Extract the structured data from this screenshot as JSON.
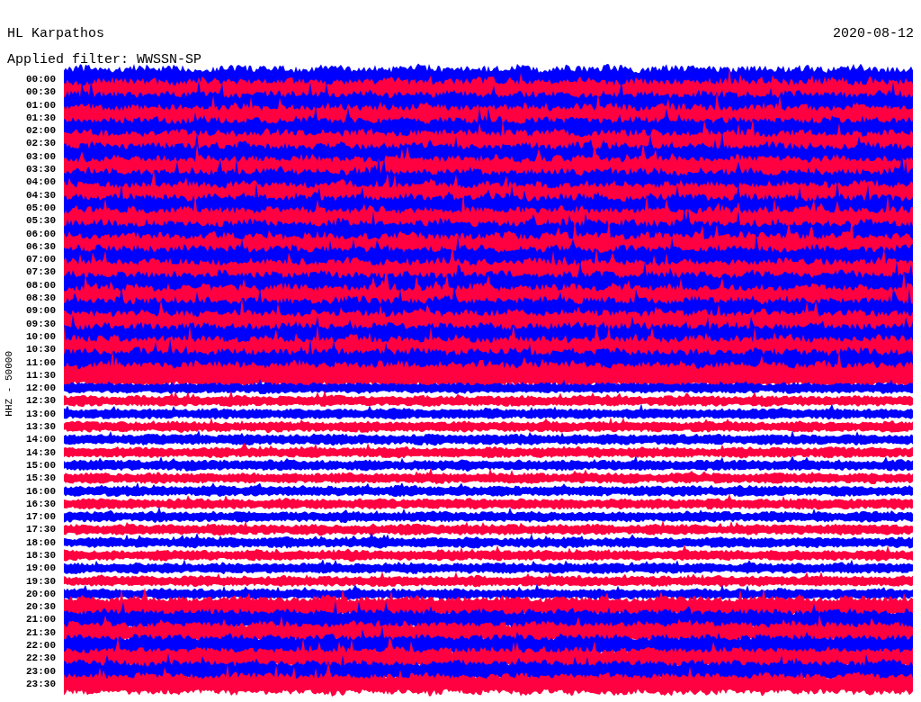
{
  "station": "HL Karpathos",
  "date": "2020-08-12",
  "filter": "Applied filter: WWSSN-SP",
  "channel": "HHZ - 50000",
  "rows": [
    {
      "time": "00:00",
      "color": "#0000ff"
    },
    {
      "time": "00:30",
      "color": "#ff0040"
    },
    {
      "time": "01:00",
      "color": "#0000ff"
    },
    {
      "time": "01:30",
      "color": "#ff0040"
    },
    {
      "time": "02:00",
      "color": "#0000ff"
    },
    {
      "time": "02:30",
      "color": "#ff0040"
    },
    {
      "time": "03:00",
      "color": "#0000ff"
    },
    {
      "time": "03:30",
      "color": "#ff0040"
    },
    {
      "time": "04:00",
      "color": "#0000ff"
    },
    {
      "time": "04:30",
      "color": "#ff0040"
    },
    {
      "time": "05:00",
      "color": "#0000ff"
    },
    {
      "time": "05:30",
      "color": "#ff0040"
    },
    {
      "time": "06:00",
      "color": "#0000ff"
    },
    {
      "time": "06:30",
      "color": "#ff0040"
    },
    {
      "time": "07:00",
      "color": "#0000ff"
    },
    {
      "time": "07:30",
      "color": "#ff0040"
    },
    {
      "time": "08:00",
      "color": "#0000ff"
    },
    {
      "time": "08:30",
      "color": "#ff0040"
    },
    {
      "time": "09:00",
      "color": "#0000ff"
    },
    {
      "time": "09:30",
      "color": "#ff0040"
    },
    {
      "time": "10:00",
      "color": "#0000ff"
    },
    {
      "time": "10:30",
      "color": "#ff0040"
    },
    {
      "time": "11:00",
      "color": "#0000ff"
    },
    {
      "time": "11:30",
      "color": "#ff0040"
    },
    {
      "time": "12:00",
      "color": "#0000ff"
    },
    {
      "time": "12:30",
      "color": "#ff0040"
    },
    {
      "time": "13:00",
      "color": "#0000ff"
    },
    {
      "time": "13:30",
      "color": "#ff0040"
    },
    {
      "time": "14:00",
      "color": "#0000ff"
    },
    {
      "time": "14:30",
      "color": "#ff0040"
    },
    {
      "time": "15:00",
      "color": "#0000ff"
    },
    {
      "time": "15:30",
      "color": "#ff0040"
    },
    {
      "time": "16:00",
      "color": "#0000ff"
    },
    {
      "time": "16:30",
      "color": "#ff0040"
    },
    {
      "time": "17:00",
      "color": "#0000ff"
    },
    {
      "time": "17:30",
      "color": "#ff0040"
    },
    {
      "time": "18:00",
      "color": "#0000ff"
    },
    {
      "time": "18:30",
      "color": "#ff0040"
    },
    {
      "time": "19:00",
      "color": "#0000ff"
    },
    {
      "time": "19:30",
      "color": "#ff0040"
    },
    {
      "time": "20:00",
      "color": "#0000ff"
    },
    {
      "time": "20:30",
      "color": "#ff0040"
    },
    {
      "time": "21:00",
      "color": "#0000ff"
    },
    {
      "time": "21:30",
      "color": "#ff0040"
    },
    {
      "time": "22:00",
      "color": "#0000ff"
    },
    {
      "time": "22:30",
      "color": "#ff0040"
    },
    {
      "time": "23:00",
      "color": "#0000ff"
    },
    {
      "time": "23:30",
      "color": "#ff0040"
    }
  ]
}
